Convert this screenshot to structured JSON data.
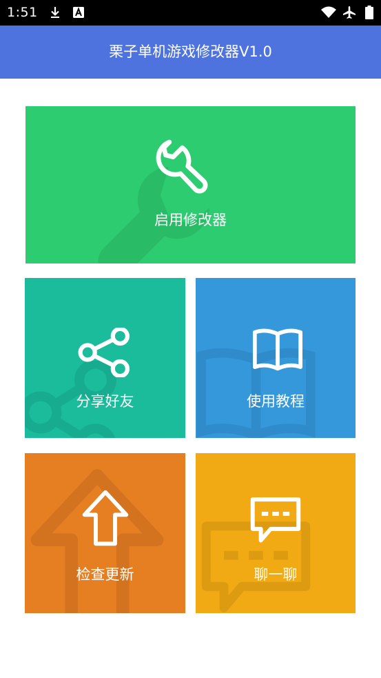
{
  "status_bar": {
    "time": "1:51",
    "left_icons": [
      "download-icon",
      "a-badge-icon"
    ],
    "right_icons": [
      "wifi-icon",
      "airplane-icon",
      "battery-icon"
    ]
  },
  "app_bar": {
    "title": "栗子单机游戏修改器V1.0",
    "color": "#4f73de"
  },
  "tiles": [
    {
      "label": "启用修改器",
      "icon": "wrench-icon",
      "color": "#2ecc71"
    },
    {
      "label": "分享好友",
      "icon": "share-icon",
      "color": "#1abc9c"
    },
    {
      "label": "使用教程",
      "icon": "book-icon",
      "color": "#3498db"
    },
    {
      "label": "检查更新",
      "icon": "arrow-up-icon",
      "color": "#e67e22"
    },
    {
      "label": "聊一聊",
      "icon": "chat-bubble-icon",
      "color": "#f1a914"
    }
  ]
}
